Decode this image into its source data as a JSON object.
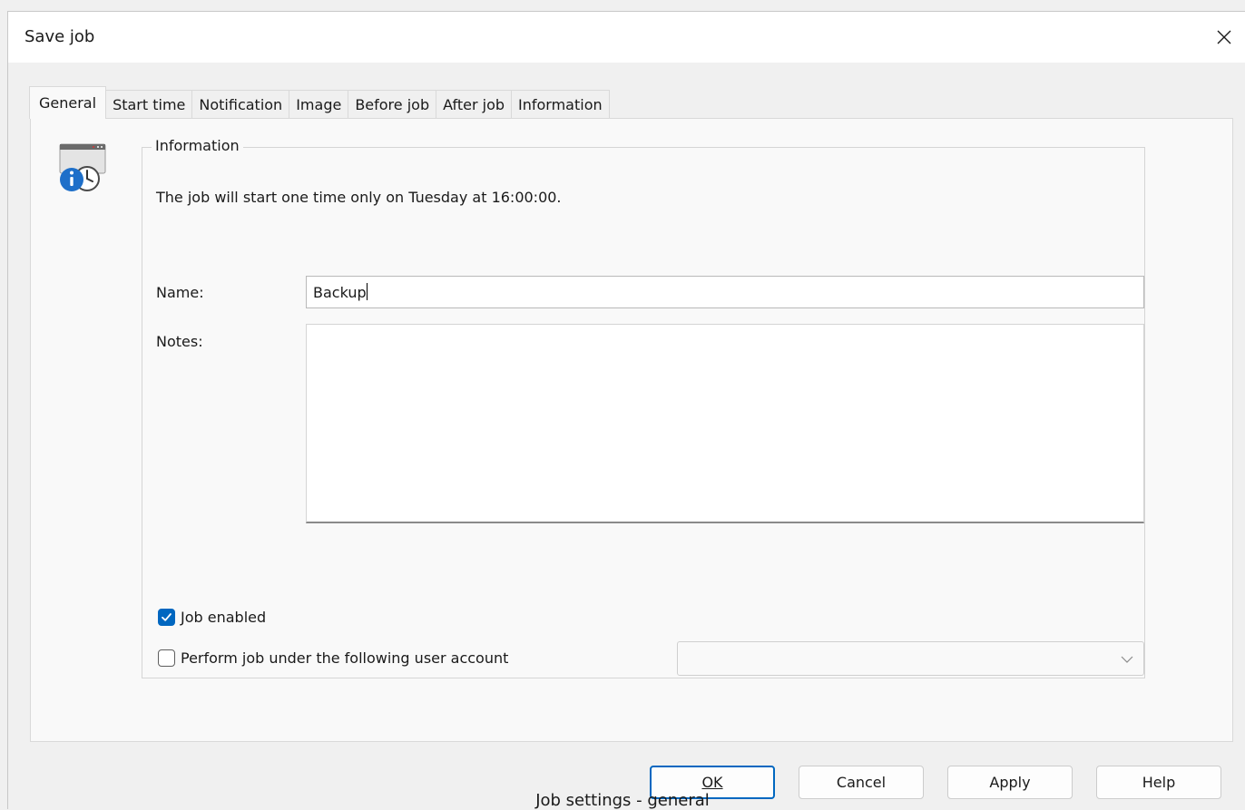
{
  "window": {
    "title": "Save job",
    "close_icon": "close-icon"
  },
  "tabs": [
    {
      "label": "General",
      "active": true
    },
    {
      "label": "Start time",
      "active": false
    },
    {
      "label": "Notification",
      "active": false
    },
    {
      "label": "Image",
      "active": false
    },
    {
      "label": "Before job",
      "active": false
    },
    {
      "label": "After job",
      "active": false
    },
    {
      "label": "Information",
      "active": false
    }
  ],
  "general": {
    "icon": "info-clock-icon",
    "group_label": "Information",
    "info_text": "The job will start one time only on Tuesday at 16:00:00.",
    "name_label": "Name:",
    "name_value": "Backup",
    "notes_label": "Notes:",
    "notes_value": "",
    "job_enabled_label": "Job enabled",
    "job_enabled_checked": true,
    "user_account_label": "Perform job under the following user account",
    "user_account_checked": false,
    "user_account_value": ""
  },
  "buttons": {
    "ok_label": "OK",
    "cancel_label": "Cancel",
    "apply_label": "Apply",
    "help_label": "Help"
  },
  "caption": "Job settings - general",
  "colors": {
    "accent": "#0067c0",
    "info_blue": "#1e6fc9"
  }
}
